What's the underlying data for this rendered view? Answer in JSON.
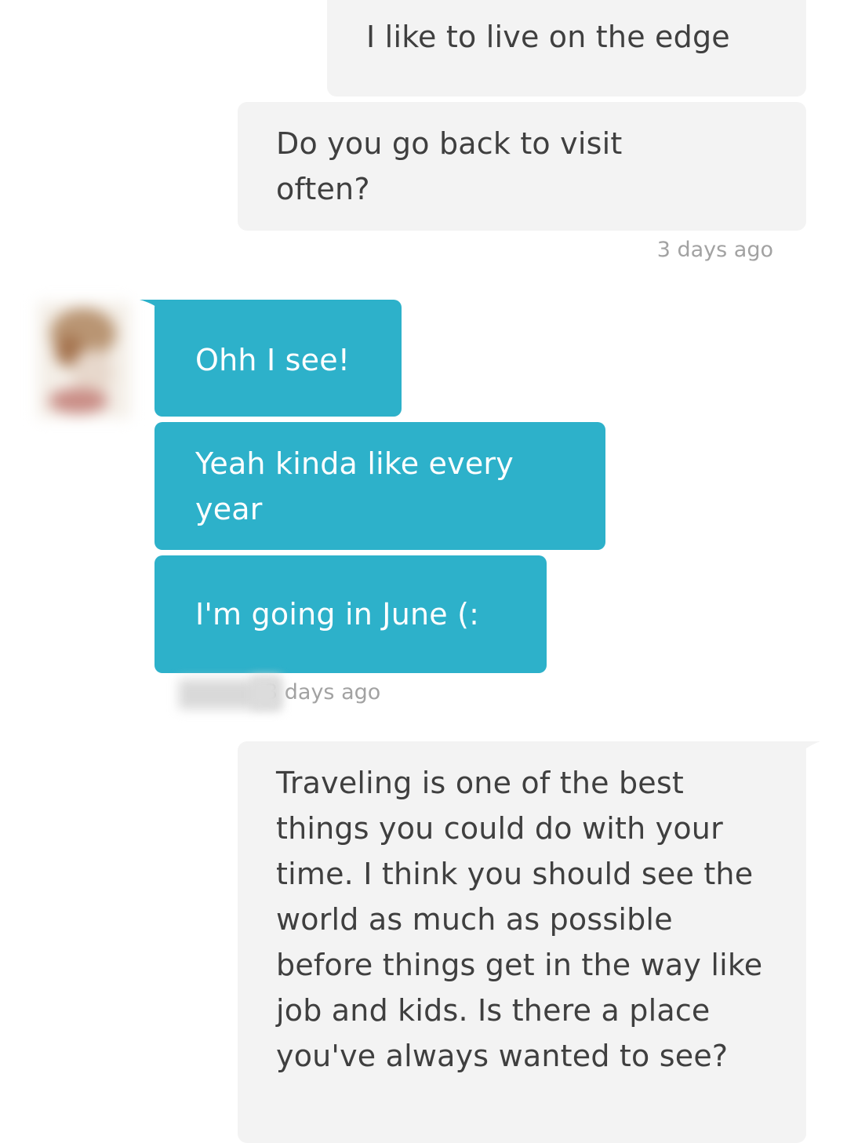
{
  "colors": {
    "outgoing_bubble": "#f3f3f3",
    "incoming_bubble": "#2db1ca",
    "timestamp": "#a2a2a2"
  },
  "messages": [
    {
      "id": "m1",
      "direction": "outgoing",
      "text": "I like to live on the edge"
    },
    {
      "id": "m2",
      "direction": "outgoing",
      "text": "Do you go back to visit often?"
    },
    {
      "id": "m3",
      "direction": "incoming",
      "text": "Ohh I see!"
    },
    {
      "id": "m4",
      "direction": "incoming",
      "text": "Yeah kinda like every year"
    },
    {
      "id": "m5",
      "direction": "incoming",
      "text": "I'm going in June (:"
    },
    {
      "id": "m6",
      "direction": "outgoing",
      "text": "Traveling is one of the best things you could do with your time. I think you should see the world as much as possible before things get in the way like job and kids. Is there a place you've always wanted to see?"
    }
  ],
  "timestamps": {
    "outgoing_group_1": "3 days ago",
    "incoming_group_1": "3 days ago"
  },
  "avatar": {
    "icon": "contact-avatar-icon",
    "blurred": true
  },
  "sender_name": {
    "blurred": true
  }
}
